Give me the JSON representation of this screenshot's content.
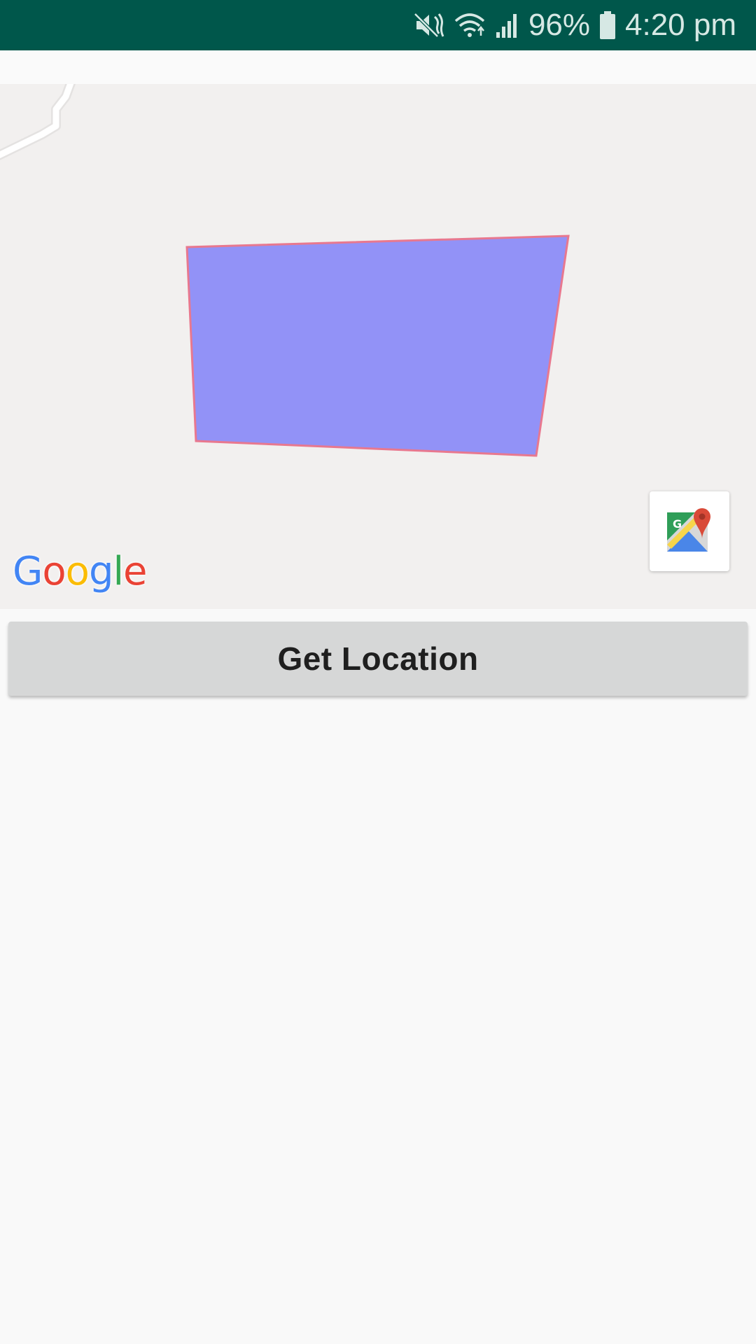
{
  "status_bar": {
    "battery_percent": "96%",
    "time": "4:20 pm",
    "icons": [
      "mute-icon",
      "wifi-icon",
      "signal-icon",
      "battery-icon"
    ],
    "background_color": "#00574b"
  },
  "map": {
    "attribution": [
      "G",
      "o",
      "o",
      "g",
      "l",
      "e"
    ],
    "polygon": {
      "fill_color": "#9292f7",
      "stroke_color": "#e8788f"
    },
    "road_color": "#ffffff",
    "background_color": "#f2f0ef",
    "map_toolbar_icon": "google-maps-icon"
  },
  "actions": {
    "get_location_label": "Get Location"
  }
}
